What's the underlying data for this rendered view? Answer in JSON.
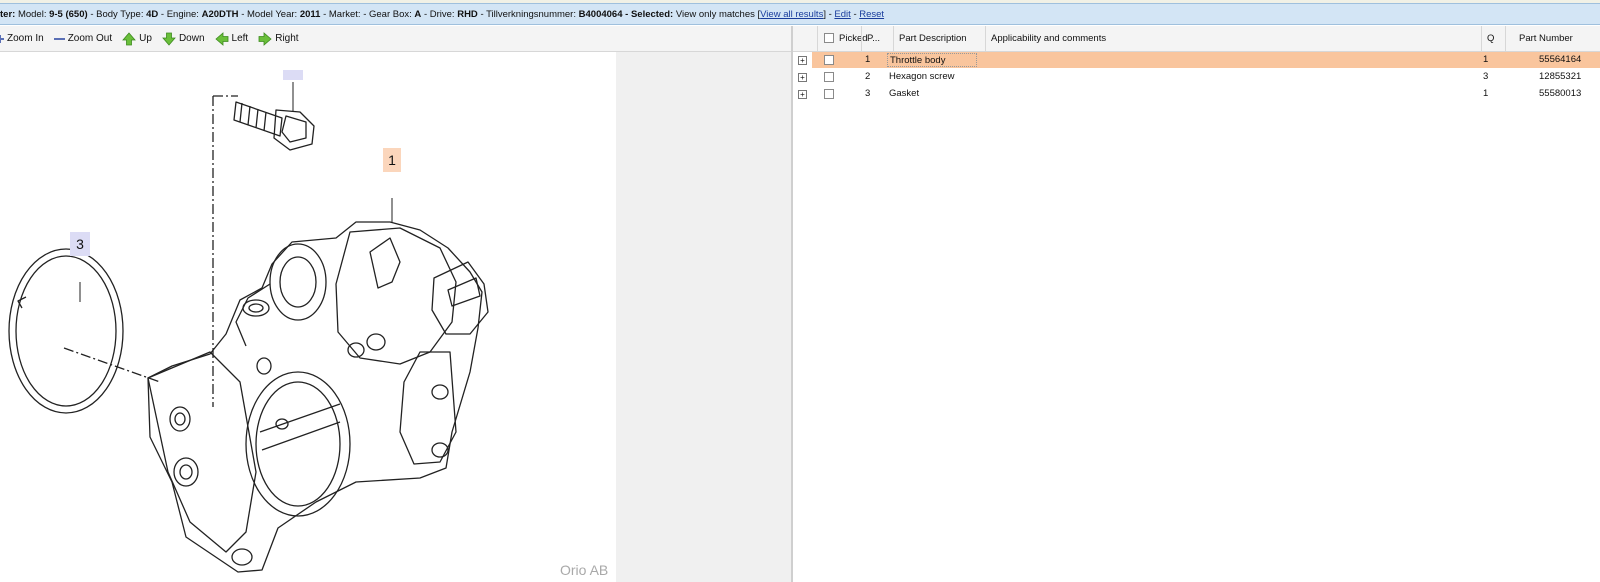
{
  "filter": {
    "prefix": "ter:",
    "model_label": "Model:",
    "model": "9-5 (650)",
    "body_label": "- Body Type:",
    "body": "4D",
    "engine_label": "- Engine:",
    "engine": "A20DTH",
    "year_label": "- Model Year:",
    "year": "2011",
    "market_label": "- Market:",
    "gearbox_label": "- Gear Box:",
    "gearbox": "A",
    "drive_label": "- Drive:",
    "drive": "RHD",
    "tillv_label": "- Tillverkningsnummer:",
    "tillv": "B4004064",
    "selected_label": "- Selected:",
    "selected_text": "View only matches",
    "view_all_open": "[",
    "view_all": "View all results",
    "view_all_close": "]",
    "sep1": "-",
    "edit": "Edit",
    "sep2": "-",
    "reset": "Reset"
  },
  "toolbar": {
    "zoom_in": "Zoom In",
    "zoom_out": "Zoom Out",
    "up": "Up",
    "down": "Down",
    "left": "Left",
    "right": "Right"
  },
  "diagram": {
    "callouts": [
      "1",
      "3"
    ],
    "watermark": "Orio AB",
    "colors": {
      "callout1_bg": "#fbd6bc",
      "callout3_bg": "#dcdcf5"
    }
  },
  "table": {
    "headers": {
      "picked": "Picked",
      "pos": "P...",
      "description": "Part Description",
      "applicability": "Applicability and comments",
      "qty": "Q",
      "part_number": "Part Number"
    },
    "rows": [
      {
        "pos": "1",
        "description": "Throttle body",
        "qty": "1",
        "part_number": "55564164",
        "selected": true
      },
      {
        "pos": "2",
        "description": "Hexagon screw",
        "qty": "3",
        "part_number": "12855321",
        "selected": false
      },
      {
        "pos": "3",
        "description": "Gasket",
        "qty": "1",
        "part_number": "55580013",
        "selected": false
      }
    ],
    "colors": {
      "selected_row": "#f9c59d"
    }
  }
}
